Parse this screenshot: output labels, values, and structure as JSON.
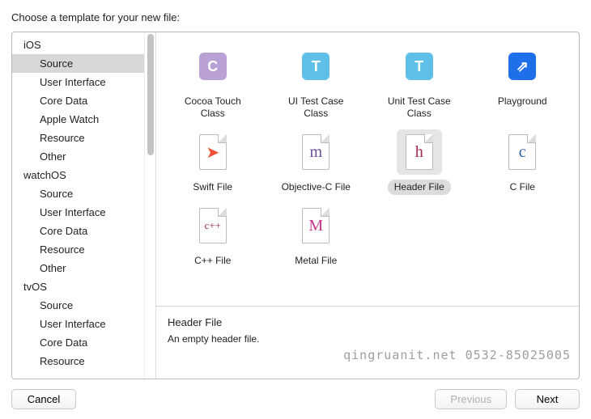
{
  "title": "Choose a template for your new file:",
  "sidebar": {
    "groups": [
      {
        "name": "iOS",
        "items": [
          "Source",
          "User Interface",
          "Core Data",
          "Apple Watch",
          "Resource",
          "Other"
        ],
        "selected": 0
      },
      {
        "name": "watchOS",
        "items": [
          "Source",
          "User Interface",
          "Core Data",
          "Resource",
          "Other"
        ]
      },
      {
        "name": "tvOS",
        "items": [
          "Source",
          "User Interface",
          "Core Data",
          "Resource"
        ]
      }
    ]
  },
  "templates": [
    {
      "id": "cocoa-touch-class",
      "label": "Cocoa Touch Class",
      "icon": "tile",
      "glyph": "C",
      "color": "#B9A1D6"
    },
    {
      "id": "ui-test-case-class",
      "label": "UI Test Case Class",
      "icon": "tile",
      "glyph": "T",
      "color": "#5EC0E8"
    },
    {
      "id": "unit-test-case-class",
      "label": "Unit Test Case Class",
      "icon": "tile",
      "glyph": "T",
      "color": "#5EC0E8"
    },
    {
      "id": "playground",
      "label": "Playground",
      "icon": "tile",
      "glyph": "⇗",
      "color": "#1F6FEB"
    },
    {
      "id": "swift-file",
      "label": "Swift File",
      "icon": "page",
      "glyph": "➤",
      "glyphClass": "swift-bird"
    },
    {
      "id": "objective-c-file",
      "label": "Objective-C File",
      "icon": "page",
      "glyph": "m",
      "glyphColor": "#6B4E9B"
    },
    {
      "id": "header-file",
      "label": "Header File",
      "icon": "page",
      "glyph": "h",
      "glyphColor": "#A02B4B",
      "selected": true
    },
    {
      "id": "c-file",
      "label": "C File",
      "icon": "page",
      "glyph": "c",
      "glyphColor": "#2F5FA8"
    },
    {
      "id": "cpp-file",
      "label": "C++ File",
      "icon": "page",
      "glyph": "c++",
      "glyphColor": "#A02B4B",
      "glyphSize": "13px"
    },
    {
      "id": "metal-file",
      "label": "Metal File",
      "icon": "page",
      "glyph": "M",
      "glyphColor": "#C7368C"
    }
  ],
  "description": {
    "title": "Header File",
    "body": "An empty header file."
  },
  "watermark": "qingruanit.net 0532-85025005",
  "buttons": {
    "cancel": "Cancel",
    "previous": "Previous",
    "next": "Next"
  }
}
